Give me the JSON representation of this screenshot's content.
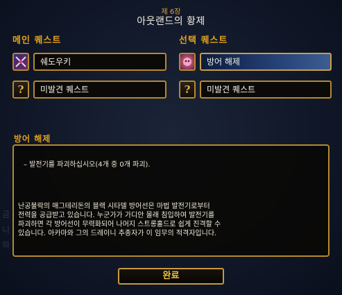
{
  "header": {
    "chapter": "제 6장",
    "title": "아웃랜드의 황제"
  },
  "main_quests": {
    "label": "메인 퀘스트",
    "items": [
      {
        "name": "쉐도우키",
        "icon": "crossed-swords-icon"
      },
      {
        "name": "미발견 퀘스트",
        "icon": "question-mark-icon"
      }
    ]
  },
  "optional_quests": {
    "label": "선택 퀘스트",
    "items": [
      {
        "name": "방어 해제",
        "icon": "pink-creature-icon",
        "selected": true
      },
      {
        "name": "미발견 퀘스트",
        "icon": "question-mark-icon"
      }
    ]
  },
  "detail": {
    "title": "방어 해제",
    "objective": "–  발전기를 파괴하십시오(4개 중 0개 파괴).",
    "description": "난공불락의 매그테리돈의 블랙 시타델 방어선은 마법 발전기로부터\n전력을 공급받고 있습니다. 누군가가 가디안 몰래 침입하여 발전기를\n파괴하면 각 방어선이 무력화되어 나머지 스트롱홀드로 쉽게 진격할 수\n있습니다. 아카마와 그의 드레이니 추종자가 이 임무의 적격자입니다."
  },
  "buttons": {
    "complete": "완료"
  },
  "colors": {
    "gold_border": "#b48a2c",
    "section_orange": "#e3a11b",
    "selected_blue": "#233f73"
  }
}
